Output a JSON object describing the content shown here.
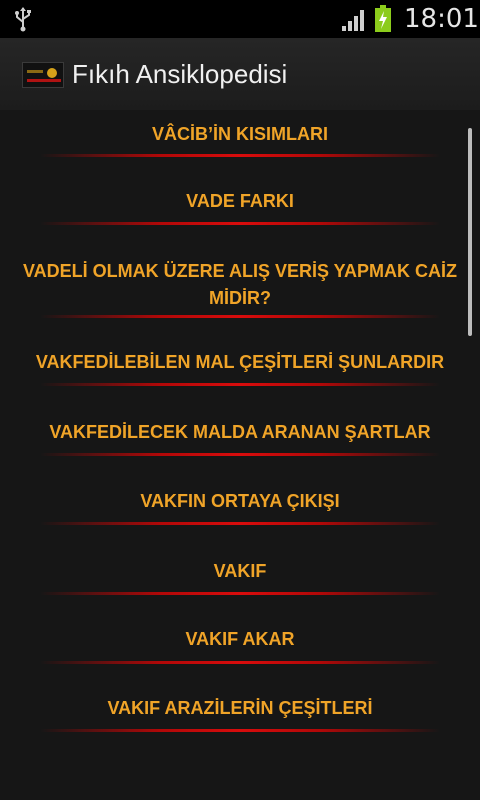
{
  "status_bar": {
    "time": "18:01",
    "icons": [
      "usb-icon",
      "signal-icon",
      "battery-charging-icon"
    ]
  },
  "action_bar": {
    "title": "Fıkıh Ansiklopedisi",
    "icon": "app-logo-icon"
  },
  "list": {
    "items": [
      {
        "label": "VÂCİB’İN KISIMLARI"
      },
      {
        "label": "VADE FARKI"
      },
      {
        "label": "VADELİ OLMAK ÜZERE ALIŞ VERİŞ YAPMAK CAİZ MİDİR?"
      },
      {
        "label": "VAKFEDİLEBİLEN MAL ÇEŞİTLERİ ŞUNLARDIR"
      },
      {
        "label": "VAKFEDİLECEK MALDA ARANAN ŞARTLAR"
      },
      {
        "label": "VAKFIN ORTAYA ÇIKIŞI"
      },
      {
        "label": "VAKIF"
      },
      {
        "label": "VAKIF AKAR"
      },
      {
        "label": "VAKIF ARAZİLERİN ÇEŞİTLERİ"
      }
    ]
  },
  "colors": {
    "item_text": "#f0a428",
    "divider": "#d80c0c",
    "background": "#161616"
  }
}
